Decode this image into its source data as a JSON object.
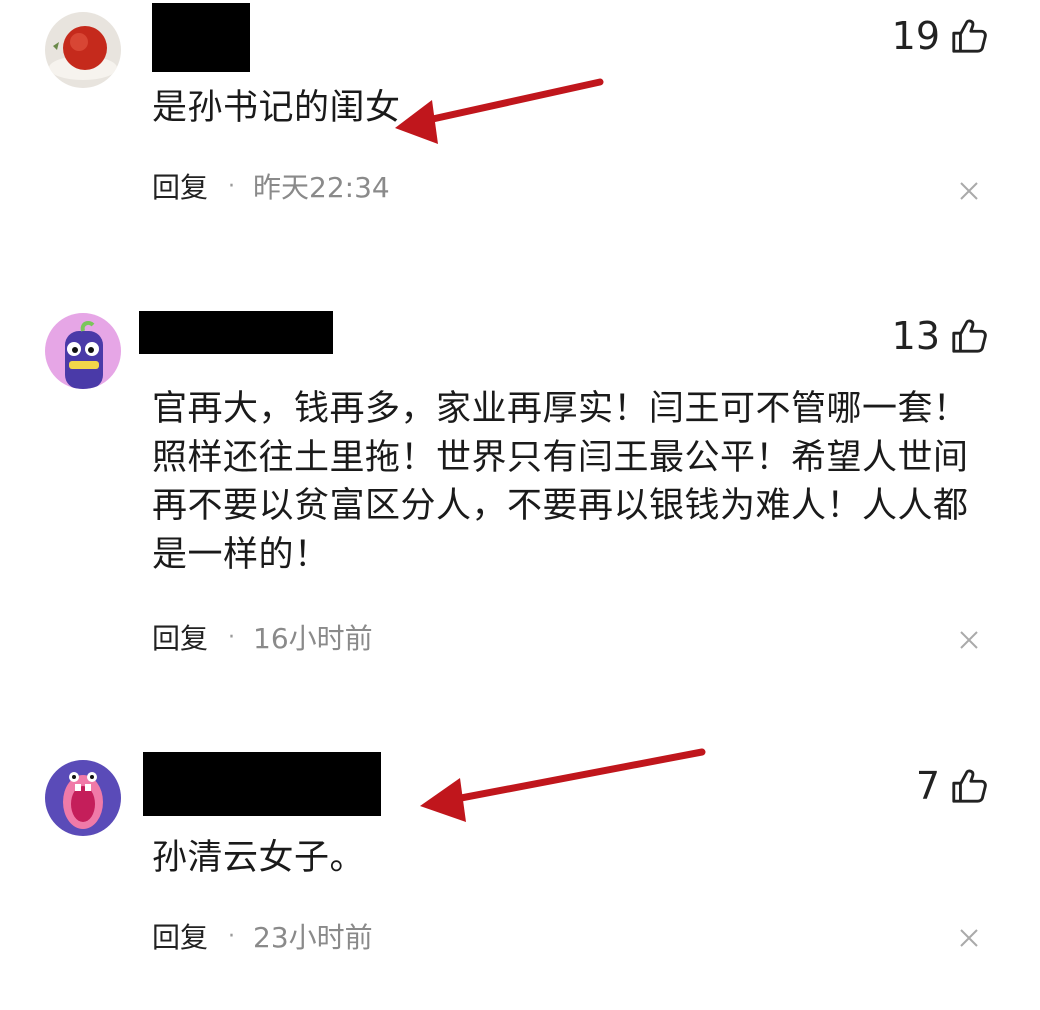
{
  "comments": [
    {
      "avatar": "apple-avatar",
      "likes": "19",
      "text": "是孙书记的闺女",
      "reply_label": "回复",
      "separator": "·",
      "time": "昨天22:34"
    },
    {
      "avatar": "purple-monster-avatar",
      "likes": "13",
      "text": "官再大，钱再多，家业再厚实！闫王可不管哪一套！照样还往土里拖！世界只有闫王最公平！希望人世间再不要以贫富区分人，不要再以银钱为难人！人人都是一样的！",
      "reply_label": "回复",
      "separator": "·",
      "time": "16小时前"
    },
    {
      "avatar": "screaming-mouth-avatar",
      "likes": "7",
      "text": "孙清云女子。",
      "reply_label": "回复",
      "separator": "·",
      "time": "23小时前"
    }
  ],
  "icons": {
    "like": "thumbs-up-icon",
    "close": "close-icon"
  },
  "colors": {
    "annotation_arrow": "#c0161c",
    "redaction": "#000000",
    "muted_text": "#8a8a8a"
  }
}
